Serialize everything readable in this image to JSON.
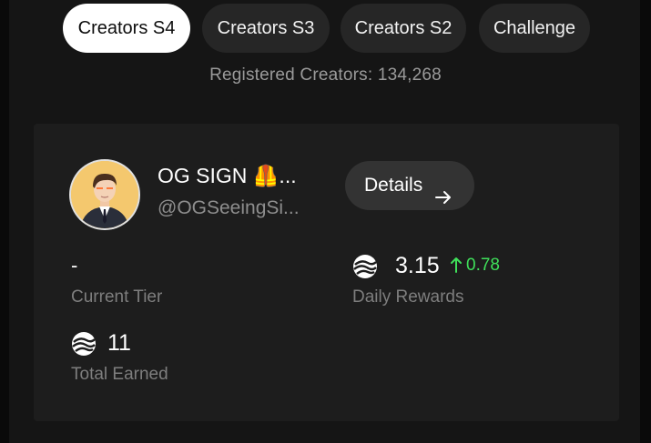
{
  "tabs": [
    {
      "label": "Creators S4",
      "active": true
    },
    {
      "label": "Creators S3",
      "active": false
    },
    {
      "label": "Creators S2",
      "active": false
    },
    {
      "label": "Challenge",
      "active": false
    }
  ],
  "registered": "Registered Creators: 134,268",
  "profile": {
    "name": "OG SIGN 🦺...",
    "handle": "@OGSeeingSi..."
  },
  "details_button": {
    "label": "Details",
    "icon": "arrow-right-icon"
  },
  "stats": {
    "current_tier": {
      "value": "-",
      "label": "Current Tier"
    },
    "daily_rewards": {
      "value": "3.15",
      "delta": "0.78",
      "label": "Daily Rewards",
      "icon": "token-icon"
    },
    "total_earned": {
      "value": "11",
      "label": "Total Earned",
      "icon": "token-icon"
    }
  },
  "colors": {
    "positive": "#3fe05a",
    "active_tab_bg": "#ffffff",
    "card_bg": "#1d1d1d"
  }
}
